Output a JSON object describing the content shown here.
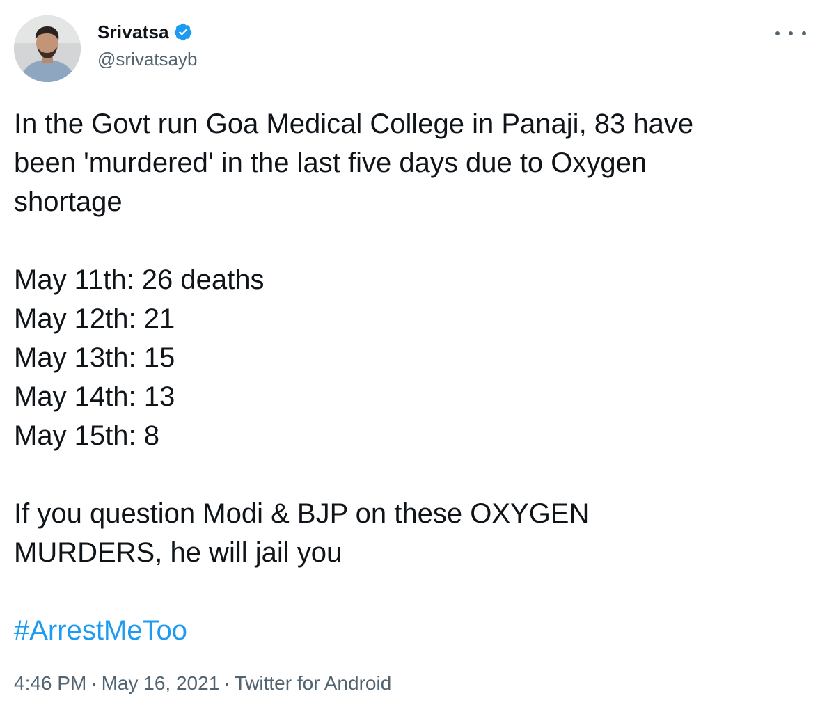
{
  "author": {
    "display_name": "Srivatsa",
    "handle": "@srivatsayb",
    "verified": true,
    "avatar_icon": "user-avatar-photo"
  },
  "tweet": {
    "line1": "In the Govt run Goa Medical College in Panaji, 83 have",
    "line2": "been 'murdered' in the last five days due to Oxygen",
    "line3": "shortage",
    "daily_list": [
      "May 11th: 26 deaths",
      "May 12th: 21",
      "May 13th: 15",
      "May 14th: 13",
      "May 15th: 8"
    ],
    "line4": "If you question Modi & BJP on these OXYGEN",
    "line5": "MURDERS, he will jail you",
    "hashtag": "#ArrestMeToo"
  },
  "meta": {
    "time": "4:46 PM",
    "separator": "·",
    "date": "May 16, 2021",
    "source": "Twitter for Android"
  },
  "colors": {
    "link": "#1d9bf0",
    "text": "#0f1419",
    "secondary": "#536471"
  },
  "icons": {
    "verified": "verified-badge-icon",
    "more": "more-options-icon"
  }
}
